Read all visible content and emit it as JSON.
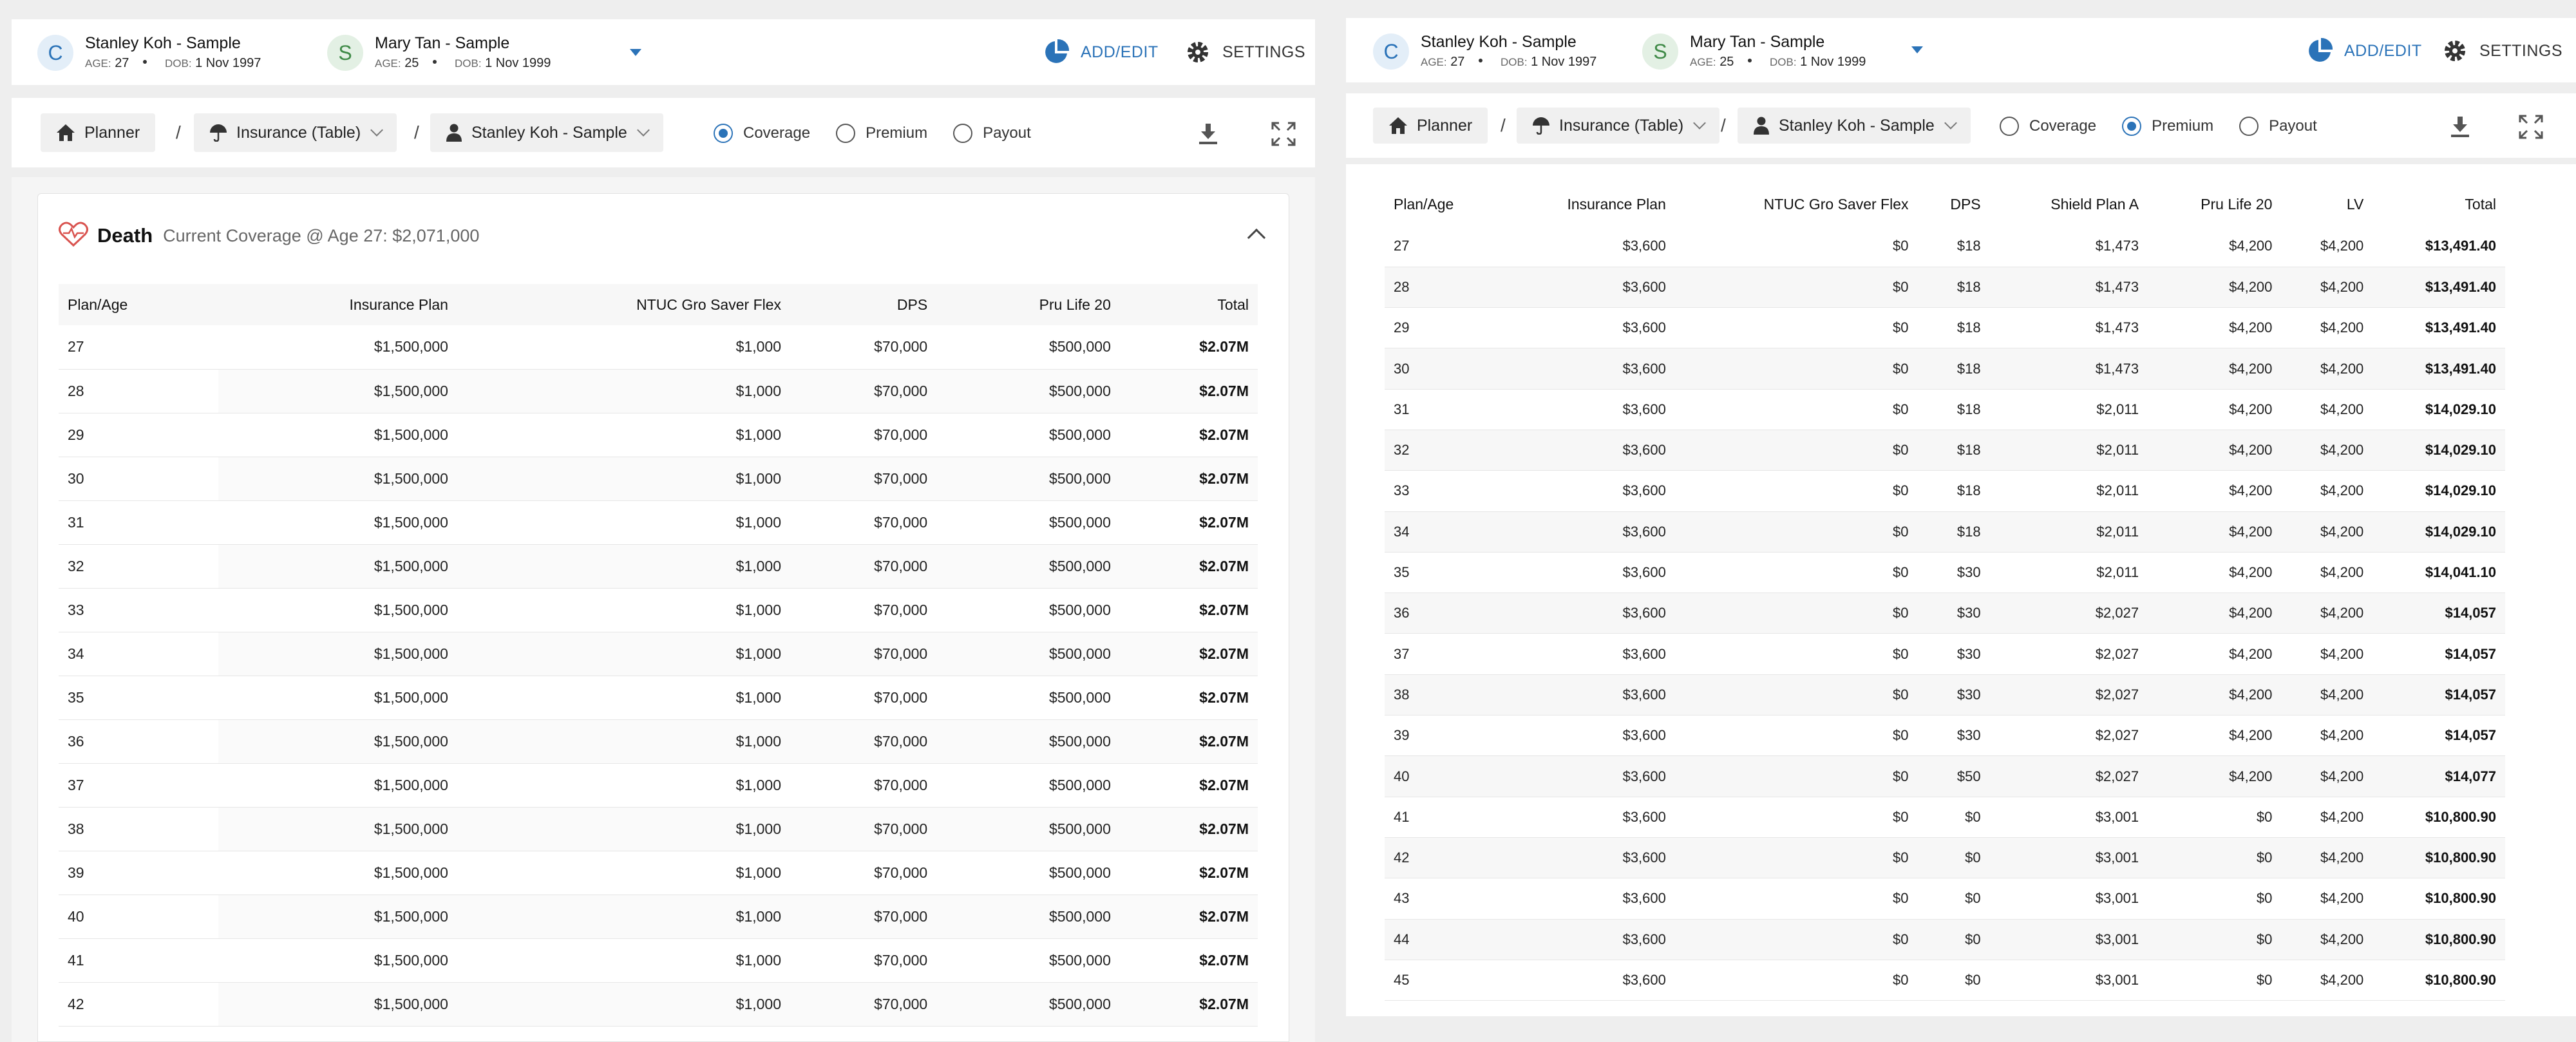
{
  "clients": [
    {
      "initial": "C",
      "name": "Stanley Koh - Sample",
      "age_label": "AGE:",
      "age": "27",
      "dob_label": "DOB:",
      "dob": "1 Nov 1997"
    },
    {
      "initial": "S",
      "name": "Mary Tan - Sample",
      "age_label": "AGE:",
      "age": "25",
      "dob_label": "DOB:",
      "dob": "1 Nov 1999"
    }
  ],
  "header": {
    "add_edit": "ADD/EDIT",
    "settings": "SETTINGS"
  },
  "breadcrumb": {
    "planner": "Planner",
    "insurance": "Insurance (Table)",
    "person": "Stanley Koh - Sample",
    "separator": "/"
  },
  "views": {
    "coverage": "Coverage",
    "premium": "Premium",
    "payout": "Payout"
  },
  "left": {
    "selected_view": "Coverage",
    "section_title": "Death",
    "section_subtitle": "Current Coverage @ Age 27: $2,071,000",
    "columns": [
      "Plan/Age",
      "Insurance Plan",
      "NTUC Gro Saver Flex",
      "DPS",
      "Pru Life 20",
      "Total"
    ],
    "rows": [
      [
        "27",
        "$1,500,000",
        "$1,000",
        "$70,000",
        "$500,000",
        "$2.07M"
      ],
      [
        "28",
        "$1,500,000",
        "$1,000",
        "$70,000",
        "$500,000",
        "$2.07M"
      ],
      [
        "29",
        "$1,500,000",
        "$1,000",
        "$70,000",
        "$500,000",
        "$2.07M"
      ],
      [
        "30",
        "$1,500,000",
        "$1,000",
        "$70,000",
        "$500,000",
        "$2.07M"
      ],
      [
        "31",
        "$1,500,000",
        "$1,000",
        "$70,000",
        "$500,000",
        "$2.07M"
      ],
      [
        "32",
        "$1,500,000",
        "$1,000",
        "$70,000",
        "$500,000",
        "$2.07M"
      ],
      [
        "33",
        "$1,500,000",
        "$1,000",
        "$70,000",
        "$500,000",
        "$2.07M"
      ],
      [
        "34",
        "$1,500,000",
        "$1,000",
        "$70,000",
        "$500,000",
        "$2.07M"
      ],
      [
        "35",
        "$1,500,000",
        "$1,000",
        "$70,000",
        "$500,000",
        "$2.07M"
      ],
      [
        "36",
        "$1,500,000",
        "$1,000",
        "$70,000",
        "$500,000",
        "$2.07M"
      ],
      [
        "37",
        "$1,500,000",
        "$1,000",
        "$70,000",
        "$500,000",
        "$2.07M"
      ],
      [
        "38",
        "$1,500,000",
        "$1,000",
        "$70,000",
        "$500,000",
        "$2.07M"
      ],
      [
        "39",
        "$1,500,000",
        "$1,000",
        "$70,000",
        "$500,000",
        "$2.07M"
      ],
      [
        "40",
        "$1,500,000",
        "$1,000",
        "$70,000",
        "$500,000",
        "$2.07M"
      ],
      [
        "41",
        "$1,500,000",
        "$1,000",
        "$70,000",
        "$500,000",
        "$2.07M"
      ],
      [
        "42",
        "$1,500,000",
        "$1,000",
        "$70,000",
        "$500,000",
        "$2.07M"
      ]
    ]
  },
  "right": {
    "selected_view": "Premium",
    "columns": [
      "Plan/Age",
      "Insurance Plan",
      "NTUC Gro Saver Flex",
      "DPS",
      "Shield Plan A",
      "Pru Life 20",
      "LV",
      "Total"
    ],
    "rows": [
      [
        "27",
        "$3,600",
        "$0",
        "$18",
        "$1,473",
        "$4,200",
        "$4,200",
        "$13,491.40"
      ],
      [
        "28",
        "$3,600",
        "$0",
        "$18",
        "$1,473",
        "$4,200",
        "$4,200",
        "$13,491.40"
      ],
      [
        "29",
        "$3,600",
        "$0",
        "$18",
        "$1,473",
        "$4,200",
        "$4,200",
        "$13,491.40"
      ],
      [
        "30",
        "$3,600",
        "$0",
        "$18",
        "$1,473",
        "$4,200",
        "$4,200",
        "$13,491.40"
      ],
      [
        "31",
        "$3,600",
        "$0",
        "$18",
        "$2,011",
        "$4,200",
        "$4,200",
        "$14,029.10"
      ],
      [
        "32",
        "$3,600",
        "$0",
        "$18",
        "$2,011",
        "$4,200",
        "$4,200",
        "$14,029.10"
      ],
      [
        "33",
        "$3,600",
        "$0",
        "$18",
        "$2,011",
        "$4,200",
        "$4,200",
        "$14,029.10"
      ],
      [
        "34",
        "$3,600",
        "$0",
        "$18",
        "$2,011",
        "$4,200",
        "$4,200",
        "$14,029.10"
      ],
      [
        "35",
        "$3,600",
        "$0",
        "$30",
        "$2,011",
        "$4,200",
        "$4,200",
        "$14,041.10"
      ],
      [
        "36",
        "$3,600",
        "$0",
        "$30",
        "$2,027",
        "$4,200",
        "$4,200",
        "$14,057"
      ],
      [
        "37",
        "$3,600",
        "$0",
        "$30",
        "$2,027",
        "$4,200",
        "$4,200",
        "$14,057"
      ],
      [
        "38",
        "$3,600",
        "$0",
        "$30",
        "$2,027",
        "$4,200",
        "$4,200",
        "$14,057"
      ],
      [
        "39",
        "$3,600",
        "$0",
        "$30",
        "$2,027",
        "$4,200",
        "$4,200",
        "$14,057"
      ],
      [
        "40",
        "$3,600",
        "$0",
        "$50",
        "$2,027",
        "$4,200",
        "$4,200",
        "$14,077"
      ],
      [
        "41",
        "$3,600",
        "$0",
        "$0",
        "$3,001",
        "$0",
        "$4,200",
        "$10,800.90"
      ],
      [
        "42",
        "$3,600",
        "$0",
        "$0",
        "$3,001",
        "$0",
        "$4,200",
        "$10,800.90"
      ],
      [
        "43",
        "$3,600",
        "$0",
        "$0",
        "$3,001",
        "$0",
        "$4,200",
        "$10,800.90"
      ],
      [
        "44",
        "$3,600",
        "$0",
        "$0",
        "$3,001",
        "$0",
        "$4,200",
        "$10,800.90"
      ],
      [
        "45",
        "$3,600",
        "$0",
        "$0",
        "$3,001",
        "$0",
        "$4,200",
        "$10,800.90"
      ]
    ]
  },
  "icons": {
    "home": "home-icon",
    "umbrella": "umbrella-icon",
    "person": "person-icon",
    "download": "download-icon",
    "fullscreen": "fullscreen-icon",
    "heart": "heart-icon",
    "pie": "pie-chart-icon",
    "gear": "gear-icon"
  },
  "colors": {
    "accent": "#2b73b8",
    "heart": "#d9534f"
  }
}
